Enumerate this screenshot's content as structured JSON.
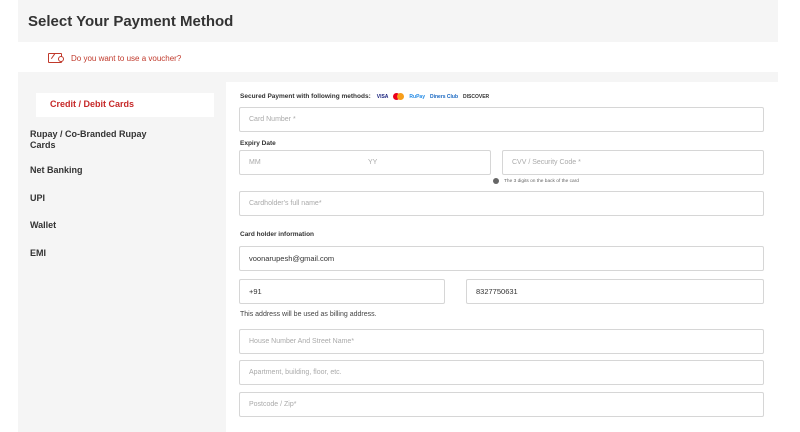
{
  "page_title": "Select Your Payment Method",
  "voucher": {
    "icon": "voucher-icon",
    "text": "Do you want to use a voucher?"
  },
  "sidebar": {
    "items": [
      {
        "label": "Credit / Debit Cards",
        "active": true
      },
      {
        "label_line1": "Rupay / Co-Branded Rupay",
        "label_line2": "Cards"
      },
      {
        "label": "Net Banking"
      },
      {
        "label": "UPI"
      },
      {
        "label": "Wallet"
      },
      {
        "label": "EMI"
      }
    ]
  },
  "secured": {
    "text": "Secured Payment with following methods:",
    "brands": {
      "visa": "VISA",
      "rupay": "RuPay",
      "diners": "Diners Club",
      "discover": "DISCOVER"
    },
    "colors": {
      "mc_red": "#eb001b",
      "mc_yellow": "#f79e1b"
    }
  },
  "card_form": {
    "card_number_placeholder": "Card Number *",
    "expiry_label": "Expiry Date",
    "expiry_mm_placeholder": "MM",
    "expiry_yy_placeholder": "YY",
    "cvv_placeholder": "CVV / Security Code *",
    "cvv_hint": "The 3 digits on the back of the card",
    "cardholder_placeholder": "Cardholder's full name*"
  },
  "holder_info": {
    "label": "Card holder information",
    "email": "voonarupesh@gmail.com",
    "country_code": "+91",
    "phone": "8327750631",
    "billing_note": "This address will be used as billing address.",
    "house_placeholder": "House Number And Street Name*",
    "apartment_placeholder": "Apartment, building, floor, etc.",
    "postcode_placeholder": "Postcode / Zip*"
  },
  "colors": {
    "accent": "#c62828",
    "panel_bg": "#f5f5f5",
    "border": "#d6d6d6"
  }
}
